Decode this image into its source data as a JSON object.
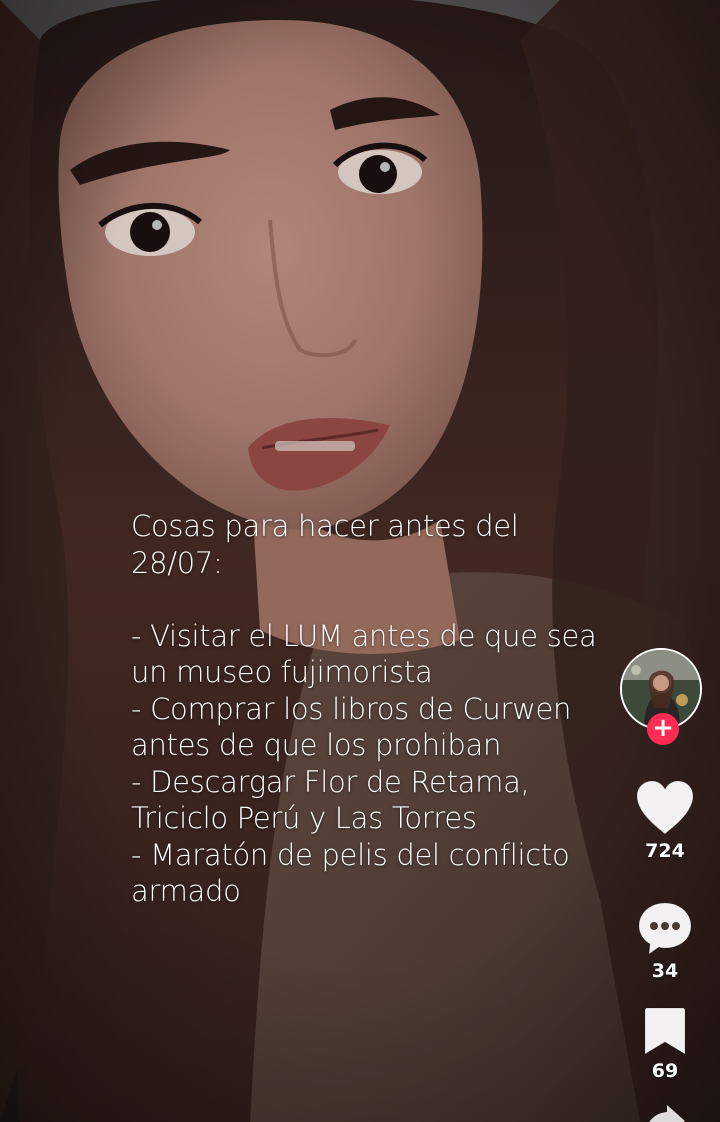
{
  "video": {
    "caption_lines": [
      "Cosas para hacer antes del",
      "28/07:",
      "",
      "- Visitar el LUM antes de que sea",
      "un museo fujimorista",
      "- Comprar los libros de Curwen",
      "antes de que los prohiban",
      "- Descargar Flor de Retama,",
      "Triciclo Perú y Las Torres",
      "- Maratón de pelis del conflicto",
      "armado"
    ]
  },
  "actions": {
    "follow_symbol": "+",
    "likes": "724",
    "comments": "34",
    "saves": "69"
  },
  "colors": {
    "follow_accent": "#fe2c55",
    "icon": "#ffffff"
  },
  "icons": {
    "avatar": "avatar",
    "follow": "plus-icon",
    "like": "heart-icon",
    "comment": "comment-bubble-icon",
    "save": "bookmark-icon",
    "share": "share-icon"
  }
}
